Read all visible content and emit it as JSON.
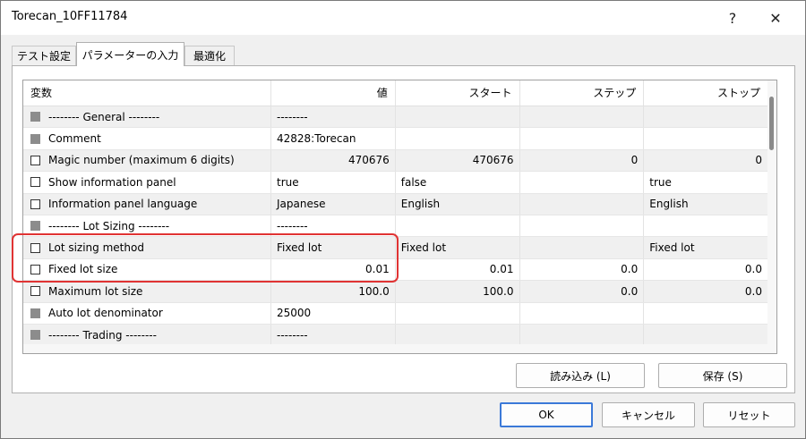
{
  "window": {
    "title": "Torecan_10FF11784",
    "help_label": "?",
    "close_label": "✕"
  },
  "tabs": [
    {
      "label": "テスト設定"
    },
    {
      "label": "パラメーターの入力"
    },
    {
      "label": "最適化"
    }
  ],
  "grid": {
    "columns": [
      "変数",
      "値",
      "スタート",
      "ステップ",
      "ストップ"
    ],
    "rows": [
      {
        "name": "-------- General --------",
        "value": "--------",
        "start": "",
        "step": "",
        "stop": ""
      },
      {
        "name": "Comment",
        "value": "42828:Torecan",
        "start": "",
        "step": "",
        "stop": ""
      },
      {
        "name": "Magic number (maximum 6 digits)",
        "value": "470676",
        "start": "470676",
        "step": "0",
        "stop": "0"
      },
      {
        "name": "Show information panel",
        "value": "true",
        "start": "false",
        "step": "",
        "stop": "true"
      },
      {
        "name": "Information panel language",
        "value": "Japanese",
        "start": "English",
        "step": "",
        "stop": "English"
      },
      {
        "name": "-------- Lot Sizing --------",
        "value": "--------",
        "start": "",
        "step": "",
        "stop": ""
      },
      {
        "name": "Lot sizing method",
        "value": "Fixed lot",
        "start": "Fixed lot",
        "step": "",
        "stop": "Fixed lot"
      },
      {
        "name": "Fixed lot size",
        "value": "0.01",
        "start": "0.01",
        "step": "0.0",
        "stop": "0.0"
      },
      {
        "name": "Maximum lot size",
        "value": "100.0",
        "start": "100.0",
        "step": "0.0",
        "stop": "0.0"
      },
      {
        "name": "Auto lot denominator",
        "value": "25000",
        "start": "",
        "step": "",
        "stop": ""
      },
      {
        "name": "-------- Trading --------",
        "value": "--------",
        "start": "",
        "step": "",
        "stop": ""
      }
    ]
  },
  "buttons": {
    "load": "読み込み (L)",
    "save": "保存 (S)",
    "ok": "OK",
    "cancel": "キャンセル",
    "reset": "リセット"
  }
}
